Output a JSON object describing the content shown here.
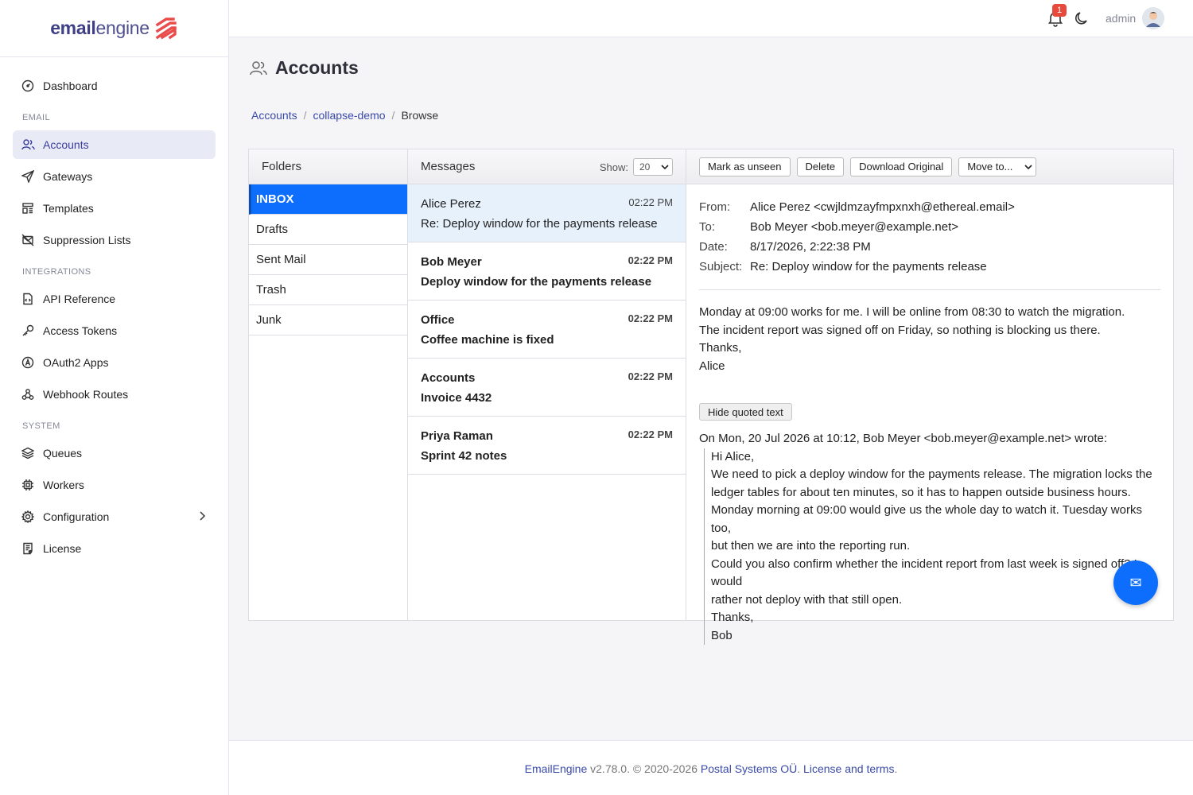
{
  "brand": {
    "name_prefix": "email",
    "name_suffix": "engine"
  },
  "sidebar": {
    "dashboard": "Dashboard",
    "heading_email": "EMAIL",
    "accounts": "Accounts",
    "gateways": "Gateways",
    "templates": "Templates",
    "suppression": "Suppression Lists",
    "heading_integrations": "INTEGRATIONS",
    "api_reference": "API Reference",
    "access_tokens": "Access Tokens",
    "oauth2_apps": "OAuth2 Apps",
    "webhook_routes": "Webhook Routes",
    "heading_system": "SYSTEM",
    "queues": "Queues",
    "workers": "Workers",
    "configuration": "Configuration",
    "license": "License"
  },
  "topbar": {
    "notification_count": "1",
    "user": "admin"
  },
  "page": {
    "title": "Accounts"
  },
  "breadcrumb": {
    "root": "Accounts",
    "account": "collapse-demo",
    "current": "Browse"
  },
  "folders": {
    "header": "Folders",
    "items": [
      "INBOX",
      "Drafts",
      "Sent Mail",
      "Trash",
      "Junk"
    ]
  },
  "messages": {
    "header": "Messages",
    "show_label": "Show:",
    "show_value": "20",
    "items": [
      {
        "from": "Alice Perez",
        "subject": "Re: Deploy window for the payments release",
        "time": "02:22 PM"
      },
      {
        "from": "Bob Meyer",
        "subject": "Deploy window for the payments release",
        "time": "02:22 PM"
      },
      {
        "from": "Office",
        "subject": "Coffee machine is fixed",
        "time": "02:22 PM"
      },
      {
        "from": "Accounts",
        "subject": "Invoice 4432",
        "time": "02:22 PM"
      },
      {
        "from": "Priya Raman",
        "subject": "Sprint 42 notes",
        "time": "02:22 PM"
      }
    ]
  },
  "toolbar": {
    "mark_unseen": "Mark as unseen",
    "delete": "Delete",
    "download": "Download Original",
    "move_to": "Move to..."
  },
  "reader": {
    "from_label": "From:",
    "from": "Alice Perez <cwjldmzayfmpxnxh@ethereal.email>",
    "to_label": "To:",
    "to": "Bob Meyer <bob.meyer@example.net>",
    "date_label": "Date:",
    "date": "8/17/2026, 2:22:38 PM",
    "subject_label": "Subject:",
    "subject": "Re: Deploy window for the payments release",
    "body": [
      "Monday at 09:00 works for me. I will be online from 08:30 to watch the migration.",
      "The incident report was signed off on Friday, so nothing is blocking us there.",
      "Thanks,",
      "Alice"
    ],
    "hide_quoted": "Hide quoted text",
    "wrote_line": "On Mon, 20 Jul 2026 at 10:12, Bob Meyer <bob.meyer@example.net> wrote:",
    "quoted": [
      "Hi Alice,",
      "We need to pick a deploy window for the payments release. The migration locks the",
      "ledger tables for about ten minutes, so it has to happen outside business hours.",
      "Monday morning at 09:00 would give us the whole day to watch it. Tuesday works too,",
      "but then we are into the reporting run.",
      "Could you also confirm whether the incident report from last week is signed off? I would",
      "rather not deploy with that still open.",
      "Thanks,",
      "Bob"
    ]
  },
  "footer": {
    "product": "EmailEngine",
    "version_copy": " v2.78.0. © 2020-2026 ",
    "company": "Postal Systems OÜ",
    "license": "License and terms",
    "end": "."
  },
  "colors": {
    "accent": "#0d6efd",
    "brand": "#3e3f86",
    "brand_logo": "#ea4c4c",
    "badge": "#e74a3b"
  }
}
